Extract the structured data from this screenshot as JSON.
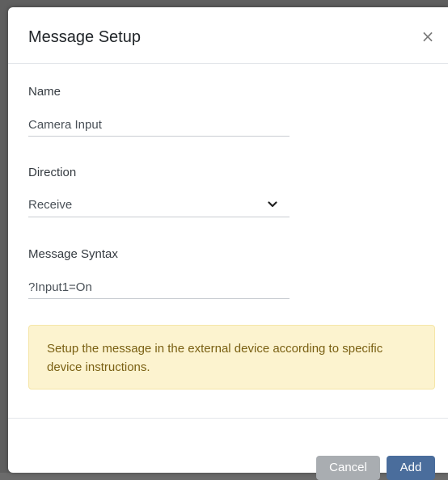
{
  "dialog": {
    "title": "Message Setup",
    "close_glyph": "×"
  },
  "fields": {
    "name": {
      "label": "Name",
      "value": "Camera Input"
    },
    "direction": {
      "label": "Direction",
      "value": "Receive"
    },
    "syntax": {
      "label": "Message Syntax",
      "value": "?Input1=On"
    }
  },
  "alert": {
    "text": "Setup the message in the external device according to specific device instructions."
  },
  "footer": {
    "cancel_label": "Cancel",
    "add_label": "Add"
  },
  "colors": {
    "primary": "#4a6d9c",
    "secondary": "#a9adb1",
    "warning_bg": "#fcf3cf",
    "warning_text": "#7a6013"
  },
  "icons": {
    "close": "close-icon",
    "dropdown": "chevron-down-icon"
  }
}
